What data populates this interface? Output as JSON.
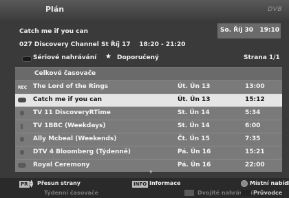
{
  "header": {
    "title": "Plán",
    "logo": "DVB"
  },
  "program": {
    "name": "Catch me if you can",
    "channel_line": "027 Discovery Channel St Říj 17    18:20 - 21:20"
  },
  "clock": "So. Říj 30   19:10",
  "legend": {
    "series": "Sériové nahrávání",
    "recommended": "Doporučený",
    "page": "Strana 1/1"
  },
  "table": {
    "section": "Celkové časovače",
    "rows": [
      {
        "icon": "rec-icon",
        "title": "The Lord of the Rings",
        "date": "Út. Ún 13",
        "time": "13:00"
      },
      {
        "icon": "series-icon",
        "title": "Catch me if you can",
        "date": "Út. Ún 13",
        "time": "15:12",
        "selected": true
      },
      {
        "icon": "timer-icon",
        "title": "TV  11 DiscoveryRTime",
        "date": "St. Ún 14",
        "time": "5:34"
      },
      {
        "icon": "reminder-icon",
        "title": "TV  1BBC (Weekdays)",
        "date": "St. Ún 14",
        "time": "6:00"
      },
      {
        "icon": "timer-icon",
        "title": "Ally Mcbeal (Weekends)",
        "date": "Čt. Ún 15",
        "time": "7:35"
      },
      {
        "icon": "timer-icon",
        "title": "DTV 4 Bloomberg (Týdenně)",
        "date": "Pá. Ún 16",
        "time": "15:21"
      },
      {
        "icon": "series-icon",
        "title": "Royal Ceremony",
        "date": "Pá. Ún 16",
        "time": "22:00"
      }
    ]
  },
  "footer": {
    "pr_key": "PR",
    "move_page": "Přesun strany",
    "info_key": "INFO",
    "info": "Informace",
    "local_menu": "Místní nabídka",
    "weekly": "Týdenní časovače",
    "double": "Dvojité nahrávání",
    "help": "Průvodce"
  }
}
